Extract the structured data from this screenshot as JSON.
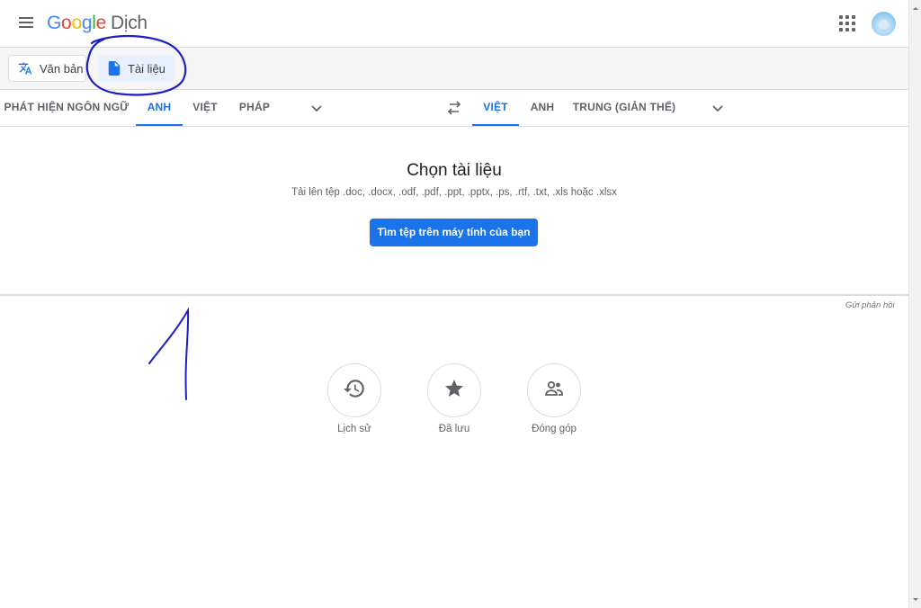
{
  "header": {
    "logo_google": "Google",
    "logo_product": "Dịch"
  },
  "modes": {
    "text_label": "Văn bản",
    "doc_label": "Tài liệu"
  },
  "source_langs": [
    "PHÁT HIỆN NGÔN NGỮ",
    "ANH",
    "VIỆT",
    "PHÁP"
  ],
  "target_langs": [
    "VIỆT",
    "ANH",
    "TRUNG (GIẢN THỂ)"
  ],
  "document": {
    "title": "Chọn tài liệu",
    "subtitle": "Tải lên tệp .doc, .docx, .odf, .pdf, .ppt, .pptx, .ps, .rtf, .txt, .xls hoặc .xlsx",
    "browse_button": "Tìm tệp trên máy tính của bạn"
  },
  "feedback": "Gửi phản hồi",
  "bottom": {
    "history": "Lịch sử",
    "saved": "Đã lưu",
    "contribute": "Đóng góp"
  },
  "colors": {
    "accent": "#1a73e8",
    "annotation": "#1c1fc4"
  },
  "icons": {
    "menu": "menu-icon",
    "apps": "apps-grid-icon",
    "translate": "translate-icon",
    "document": "document-icon",
    "swap": "swap-icon",
    "history": "history-icon",
    "saved": "star-icon",
    "contribute": "people-icon"
  }
}
